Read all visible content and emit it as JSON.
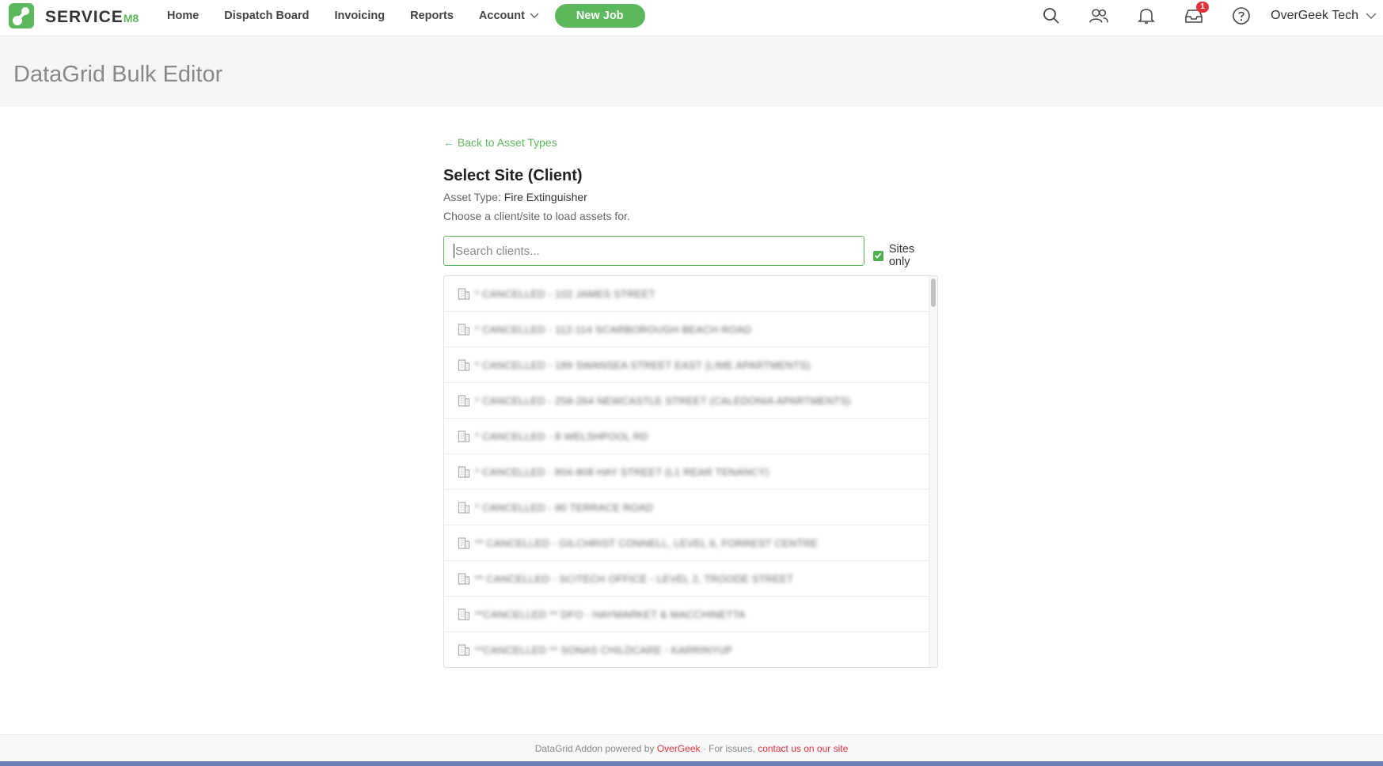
{
  "nav": {
    "brand_main": "SERVICE",
    "brand_suffix": "M8",
    "links": [
      "Home",
      "Dispatch Board",
      "Invoicing",
      "Reports"
    ],
    "account_label": "Account",
    "new_job_label": "New Job",
    "inbox_badge": "1",
    "user_name": "OverGeek Tech",
    "icons": [
      "search-icon",
      "team-icon",
      "bell-icon",
      "inbox-icon",
      "help-icon"
    ]
  },
  "page": {
    "title": "DataGrid Bulk Editor"
  },
  "content": {
    "back_link": "← Back to Asset Types",
    "section_title": "Select Site (Client)",
    "asset_type_label": "Asset Type:",
    "asset_type_value": "Fire Extinguisher",
    "help_text": "Choose a client/site to load assets for.",
    "search_placeholder": "Search clients...",
    "search_value": "",
    "sites_only_label": "Sites only",
    "sites_only_checked": true,
    "clients": [
      "* CANCELLED - 102 JAMES STREET",
      "* CANCELLED - 112-114 SCARBOROUGH BEACH ROAD",
      "* CANCELLED - 189 SWANSEA STREET EAST (LIME APARTMENTS)",
      "* CANCELLED - 258-264 NEWCASTLE STREET (CALEDONIA APARTMENTS)",
      "* CANCELLED - 8 WELSHPOOL RD",
      "* CANCELLED - 804-808 HAY STREET (L1 REAR TENANCY)",
      "* CANCELLED - 90 TERRACE ROAD",
      "** CANCELLED - GILCHRIST CONNELL, LEVEL 6, FORREST CENTRE",
      "** CANCELLED - SCITECH OFFICE - LEVEL 2, TROODE STREET",
      "**CANCELLED ** DFO - HAYMARKET & MACCHINETTA",
      "**CANCELLED ** SONAS CHILDCARE - KARRINYUP"
    ]
  },
  "footer": {
    "prefix": "DataGrid Addon powered by",
    "brand": "OverGeek",
    "middle": "· For issues,",
    "contact_link": "contact us on our site"
  },
  "colors": {
    "accent_green": "#5cb85c",
    "badge_red": "#e0333a",
    "link_red": "#e0333a"
  }
}
